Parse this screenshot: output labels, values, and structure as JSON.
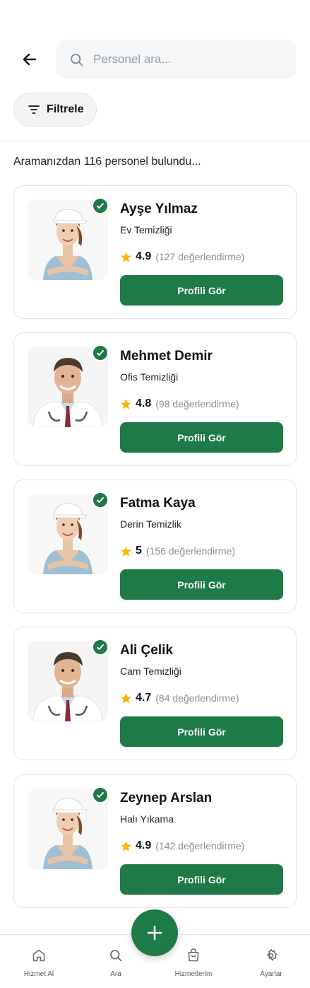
{
  "search": {
    "placeholder": "Personel ara..."
  },
  "filter": {
    "label": "Filtrele"
  },
  "results": {
    "summary": "Aramanızdan 116 personel bulundu..."
  },
  "staff": [
    {
      "name": "Ayşe Yılmaz",
      "service": "Ev Temizliği",
      "rating": "4.9",
      "reviews": "(127 değerlendirme)",
      "button": "Profili Gör",
      "photo": "female-cleaner-photo"
    },
    {
      "name": "Mehmet Demir",
      "service": "Ofis Temizliği",
      "rating": "4.8",
      "reviews": "(98 değerlendirme)",
      "button": "Profili Gör",
      "photo": "male-doctor-photo"
    },
    {
      "name": "Fatma Kaya",
      "service": "Derin Temizlik",
      "rating": "5",
      "reviews": "(156 değerlendirme)",
      "button": "Profili Gör",
      "photo": "female-cleaner-photo"
    },
    {
      "name": "Ali Çelik",
      "service": "Cam Temizliği",
      "rating": "4.7",
      "reviews": "(84 değerlendirme)",
      "button": "Profili Gör",
      "photo": "male-doctor-photo"
    },
    {
      "name": "Zeynep Arslan",
      "service": "Halı Yıkama",
      "rating": "4.9",
      "reviews": "(142 değerlendirme)",
      "button": "Profili Gör",
      "photo": "female-cleaner-photo"
    }
  ],
  "nav": [
    {
      "label": "Hizmet Al",
      "icon": "home-icon"
    },
    {
      "label": "Ara",
      "icon": "search-icon"
    },
    {
      "label": "Hizmetlerim",
      "icon": "bag-icon"
    },
    {
      "label": "Ayarlar",
      "icon": "gear-icon"
    }
  ],
  "colors": {
    "primary": "#1e7a46",
    "star": "#f5b800",
    "muted": "#8a8f96"
  }
}
